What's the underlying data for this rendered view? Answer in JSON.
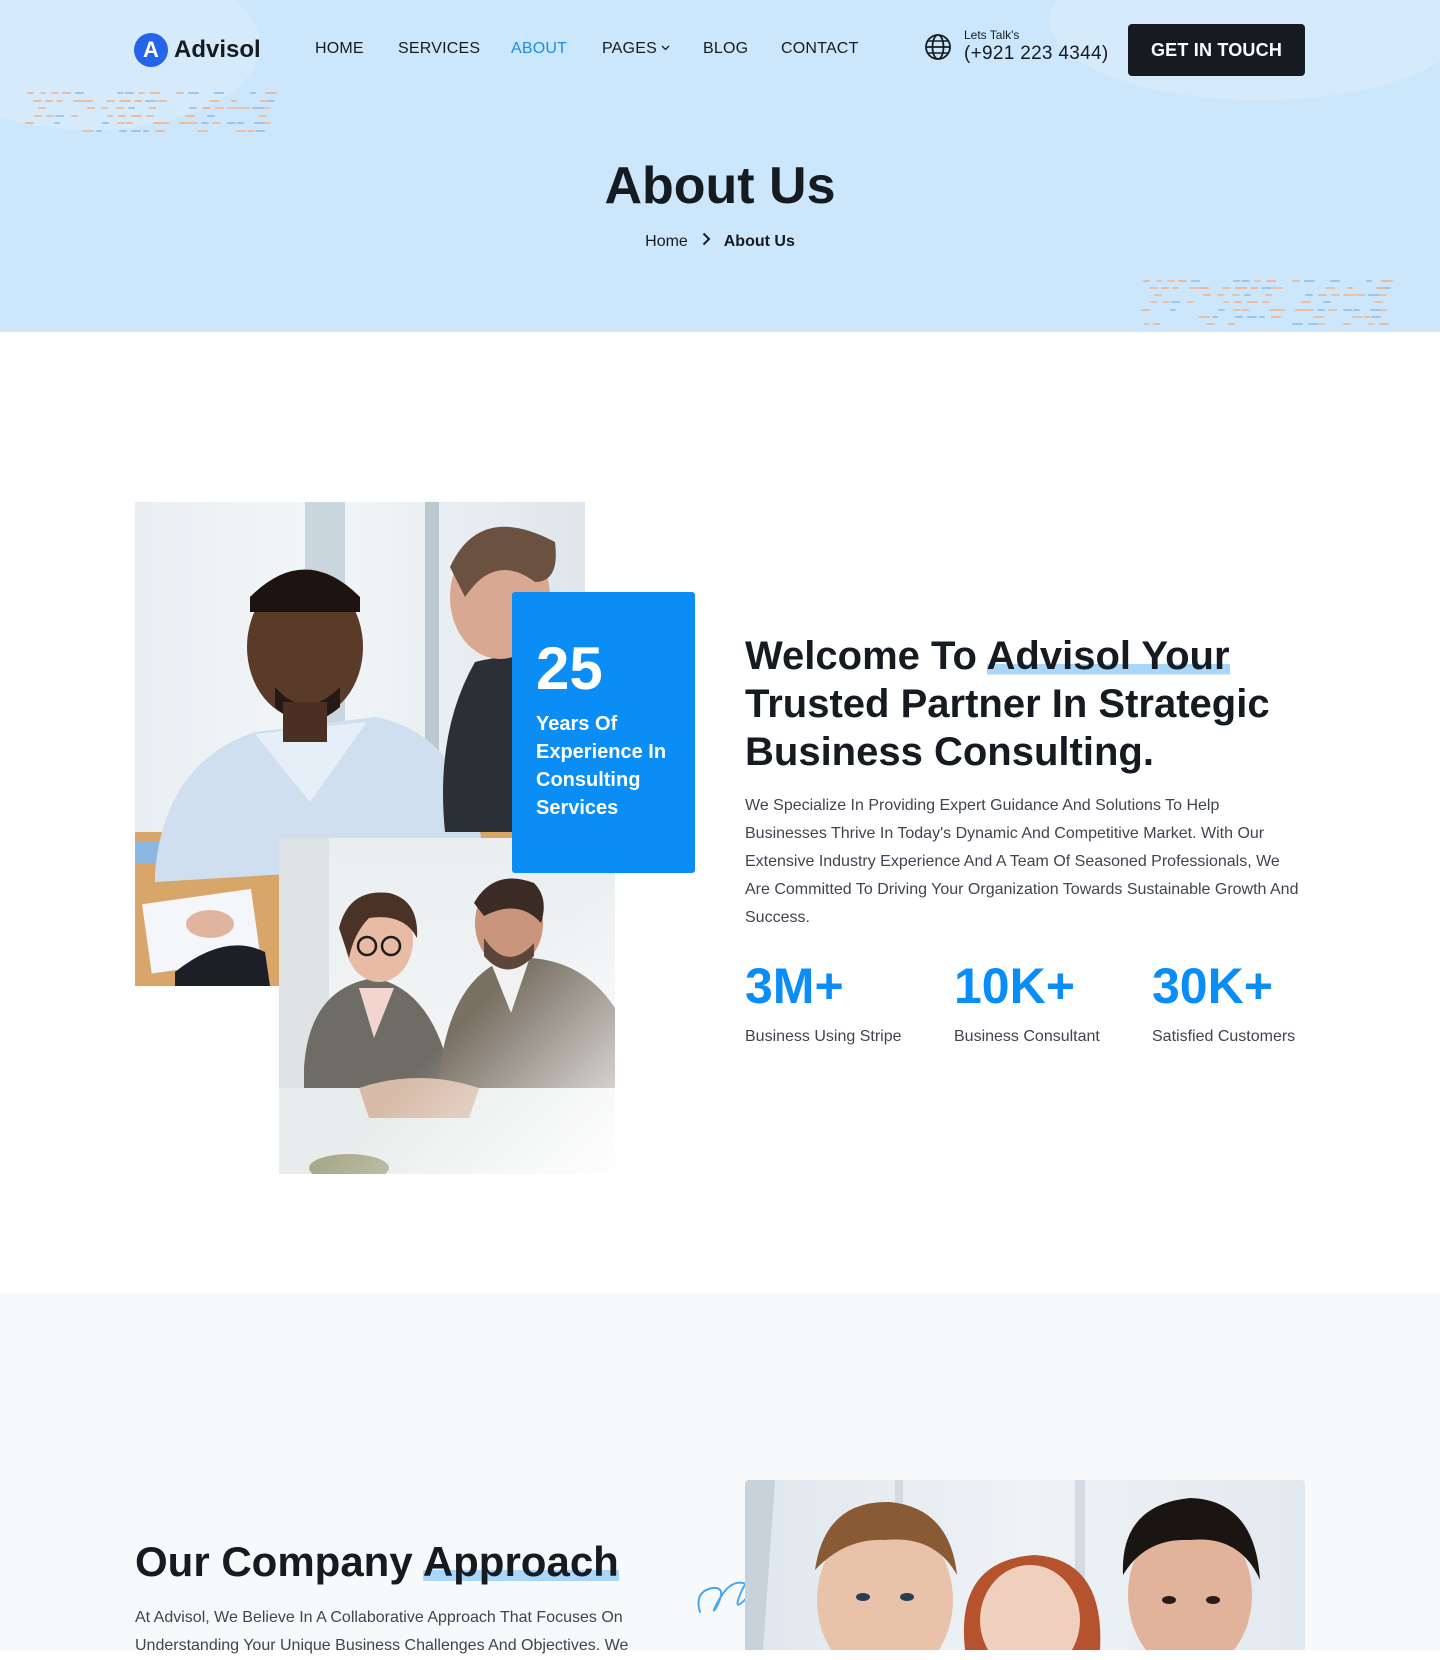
{
  "brand": {
    "logo_letter": "A",
    "name": "Advisol"
  },
  "nav": {
    "items": [
      {
        "label": "HOME"
      },
      {
        "label": "SERVICES"
      },
      {
        "label": "ABOUT"
      },
      {
        "label": "PAGES"
      },
      {
        "label": "BLOG"
      },
      {
        "label": "CONTACT"
      }
    ],
    "active": "ABOUT"
  },
  "contact": {
    "caption": "Lets Talk's",
    "phone": "(+921 223 4344)"
  },
  "cta_label": "GET IN TOUCH",
  "hero": {
    "title": "About Us",
    "breadcrumb": {
      "home": "Home",
      "current": "About Us"
    }
  },
  "about": {
    "badge": {
      "number": "25",
      "text": "Years Of Experience In Consulting Services"
    },
    "heading_pre": "Welcome To ",
    "heading_highlight": "Advisol Your",
    "heading_post": " Trusted Partner In Strategic Business Consulting.",
    "paragraph": "We Specialize In Providing Expert Guidance And Solutions To Help Businesses Thrive In Today's Dynamic And Competitive Market. With Our Extensive Industry Experience And A Team Of Seasoned Professionals, We Are Committed To Driving Your Organization Towards Sustainable Growth And Success.",
    "stats": [
      {
        "value": "3M+",
        "label": "Business Using Stripe"
      },
      {
        "value": "10K+",
        "label": "Business Consultant"
      },
      {
        "value": "30K+",
        "label": "Satisfied Customers"
      }
    ]
  },
  "approach": {
    "heading_pre": "Our Company ",
    "heading_highlight": "Approach",
    "paragraph": "At Advisol, We Believe In A Collaborative Approach That Focuses On Understanding Your Unique Business Challenges And Objectives. We"
  },
  "colors": {
    "hero_bg": "#cce7fb",
    "accent": "#0a8ef5",
    "active_nav": "#1a8ee6",
    "dark": "#161b22",
    "highlight": "#a8d7fb"
  },
  "icons": {
    "contact": "globe-icon",
    "pages_dropdown": "chevron-down-icon",
    "breadcrumb_sep": "chevron-right-icon"
  }
}
